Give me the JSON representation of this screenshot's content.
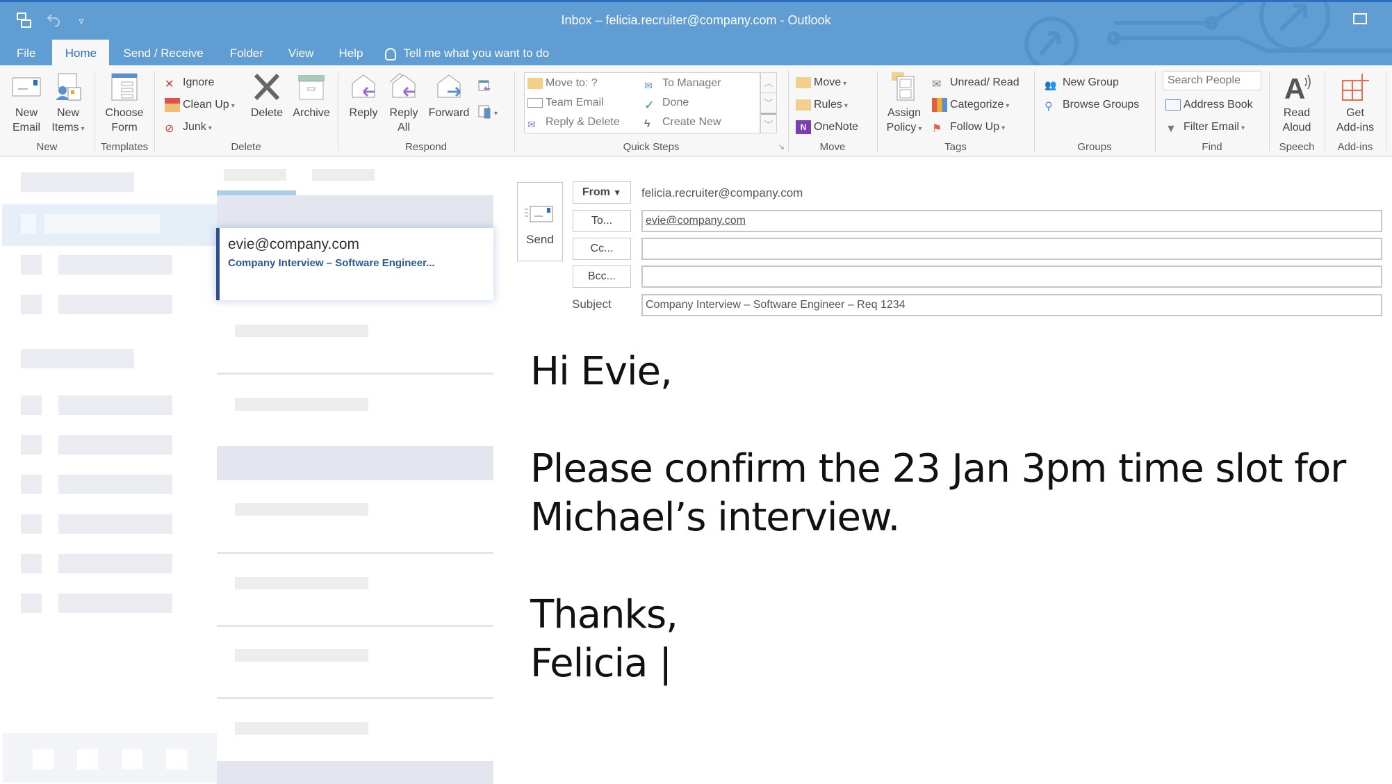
{
  "window": {
    "title": "Inbox – felicia.recruiter@company.com - Outlook"
  },
  "quick_access": {
    "icons": [
      "send-receive-all-folders-icon",
      "undo-icon",
      "customize-qat-icon"
    ]
  },
  "tabs": [
    {
      "label": "File",
      "active": false
    },
    {
      "label": "Home",
      "active": true
    },
    {
      "label": "Send / Receive",
      "active": false
    },
    {
      "label": "Folder",
      "active": false
    },
    {
      "label": "View",
      "active": false
    },
    {
      "label": "Help",
      "active": false
    }
  ],
  "tell_me": "Tell me what you want to do",
  "ribbon": {
    "new": {
      "label": "New",
      "new_email": "New\nEmail",
      "new_email_l1": "New",
      "new_email_l2": "Email",
      "new_items_l1": "New",
      "new_items_l2": "Items"
    },
    "templates": {
      "label": "Templates",
      "choose_form_l1": "Choose",
      "choose_form_l2": "Form"
    },
    "delete": {
      "label": "Delete",
      "ignore": "Ignore",
      "clean_up": "Clean Up",
      "junk": "Junk",
      "delete": "Delete",
      "archive": "Archive"
    },
    "respond": {
      "label": "Respond",
      "reply": "Reply",
      "reply_all_l1": "Reply",
      "reply_all_l2": "All",
      "forward": "Forward"
    },
    "quick_steps": {
      "label": "Quick Steps",
      "items": [
        "Move to: ?",
        "Team Email",
        "Reply & Delete",
        "To Manager",
        "Done",
        "Create New"
      ]
    },
    "move": {
      "label": "Move",
      "move": "Move",
      "rules": "Rules",
      "onenote": "OneNote"
    },
    "tags": {
      "label": "Tags",
      "assign_policy_l1": "Assign",
      "assign_policy_l2": "Policy",
      "unread_read": "Unread/ Read",
      "categorize": "Categorize",
      "follow_up": "Follow Up"
    },
    "groups": {
      "label": "Groups",
      "new_group": "New Group",
      "browse_groups": "Browse Groups"
    },
    "find": {
      "label": "Find",
      "search_people_placeholder": "Search People",
      "address_book": "Address Book",
      "filter_email": "Filter Email"
    },
    "speech": {
      "label": "Speech",
      "read_aloud_l1": "Read",
      "read_aloud_l2": "Aloud"
    },
    "addins": {
      "label": "Add-ins",
      "get_addins_l1": "Get",
      "get_addins_l2": "Add-ins"
    }
  },
  "message_list": {
    "selected": {
      "from": "evie@company.com",
      "subject": "Company Interview – Software Engineer..."
    }
  },
  "compose": {
    "send_label": "Send",
    "from_label": "From",
    "from_value": "felicia.recruiter@company.com",
    "to_label": "To...",
    "to_value": "evie@company.com",
    "cc_label": "Cc...",
    "cc_value": "",
    "bcc_label": "Bcc...",
    "bcc_value": "",
    "subject_label": "Subject",
    "subject_value": "Company Interview – Software Engineer – Req 1234",
    "body": {
      "greeting": "Hi Evie,",
      "line1": "Please confirm the 23 Jan 3pm time slot for",
      "line2": "Michael’s interview.",
      "closing": "Thanks,",
      "signature": "Felicia",
      "cursor": "|"
    }
  },
  "colors": {
    "titlebar": "#5f9dd3",
    "accent": "#2b579a",
    "ribbon_bg": "#f7f7f7",
    "skeleton": "#ebecf2"
  }
}
